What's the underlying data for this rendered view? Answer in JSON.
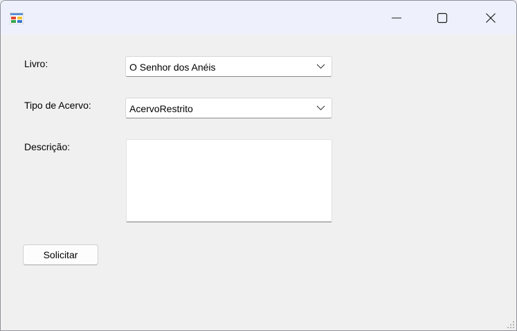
{
  "window": {
    "icon": "winforms-app-icon",
    "controls": {
      "minimize_icon": "minimize-icon",
      "maximize_icon": "maximize-icon",
      "close_icon": "close-icon"
    }
  },
  "form": {
    "livro": {
      "label": "Livro:",
      "selected": "O Senhor dos Anéis",
      "icon": "chevron-down-icon"
    },
    "tipo_acervo": {
      "label": "Tipo de Acervo:",
      "selected": "AcervoRestrito",
      "icon": "chevron-down-icon"
    },
    "descricao": {
      "label": "Descrição:",
      "value": ""
    },
    "submit_label": "Solicitar"
  },
  "colors": {
    "titlebar": "#eef1fb",
    "client": "#f0f0f0",
    "field": "#ffffff"
  }
}
